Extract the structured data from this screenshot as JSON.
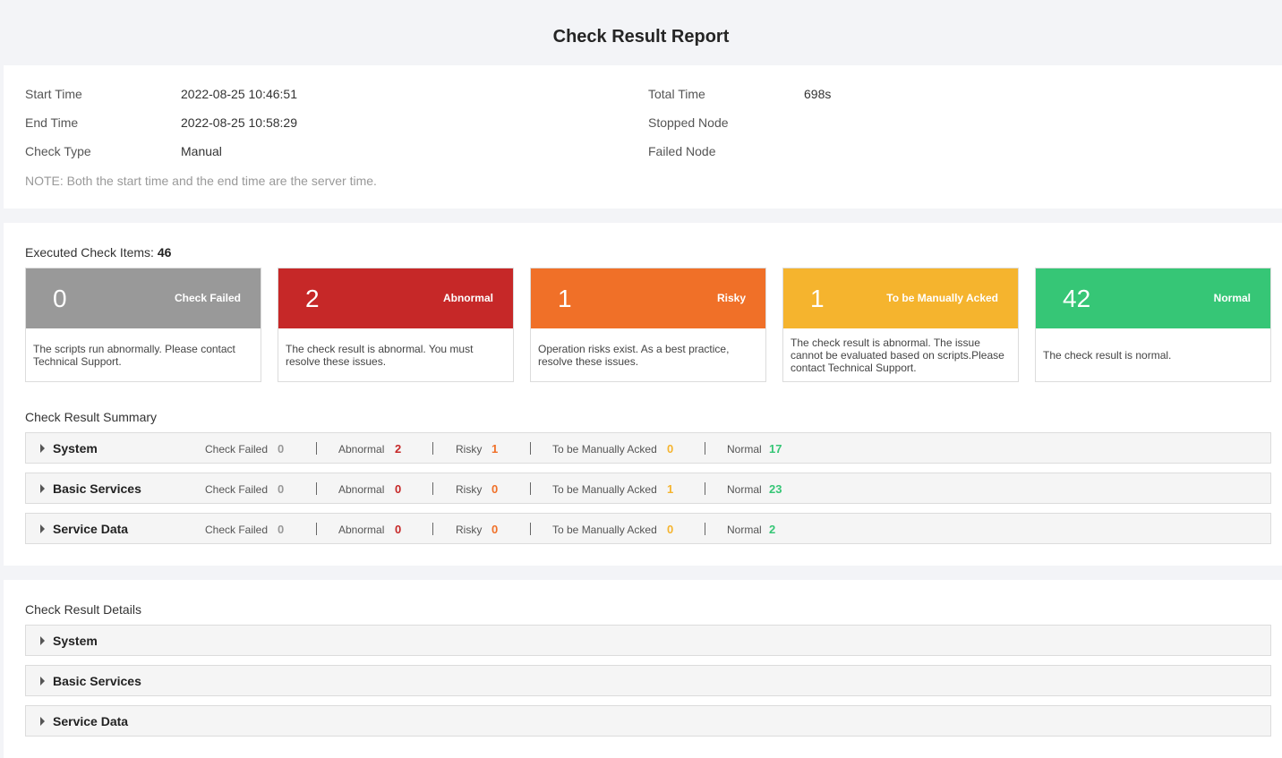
{
  "title": "Check Result Report",
  "info": {
    "start_time_label": "Start Time",
    "start_time": "2022-08-25 10:46:51",
    "end_time_label": "End Time",
    "end_time": "2022-08-25 10:58:29",
    "check_type_label": "Check Type",
    "check_type": "Manual",
    "total_time_label": "Total Time",
    "total_time": "698s",
    "stopped_node_label": "Stopped Node",
    "failed_node_label": "Failed Node",
    "note": "NOTE: Both the start time and the end time are the server time."
  },
  "executed": {
    "label": "Executed Check Items:",
    "count": "46"
  },
  "cards": [
    {
      "count": "0",
      "label": "Check Failed",
      "desc": "The scripts run abnormally. Please contact Technical Support.",
      "color": "#999999"
    },
    {
      "count": "2",
      "label": "Abnormal",
      "desc": "The check result is abnormal. You must resolve these issues.",
      "color": "#c62828"
    },
    {
      "count": "1",
      "label": "Risky",
      "desc": "Operation risks exist. As a best practice, resolve these issues.",
      "color": "#f07028"
    },
    {
      "count": "1",
      "label": "To be Manually Acked",
      "desc": "The check result is abnormal. The issue cannot be evaluated based on scripts.Please contact Technical Support.",
      "color": "#f5b42e"
    },
    {
      "count": "42",
      "label": "Normal",
      "desc": "The check result is normal.",
      "color": "#36c676"
    }
  ],
  "summary": {
    "label": "Check Result Summary",
    "stat_labels": {
      "failed": "Check Failed",
      "abnormal": "Abnormal",
      "risky": "Risky",
      "acked": "To be Manually Acked",
      "normal": "Normal"
    },
    "rows": [
      {
        "name": "System",
        "failed": "0",
        "abnormal": "2",
        "risky": "1",
        "acked": "0",
        "normal": "17"
      },
      {
        "name": "Basic Services",
        "failed": "0",
        "abnormal": "0",
        "risky": "0",
        "acked": "1",
        "normal": "23"
      },
      {
        "name": "Service Data",
        "failed": "0",
        "abnormal": "0",
        "risky": "0",
        "acked": "0",
        "normal": "2"
      }
    ]
  },
  "details": {
    "label": "Check Result Details",
    "rows": [
      {
        "name": "System"
      },
      {
        "name": "Basic Services"
      },
      {
        "name": "Service Data"
      }
    ]
  }
}
